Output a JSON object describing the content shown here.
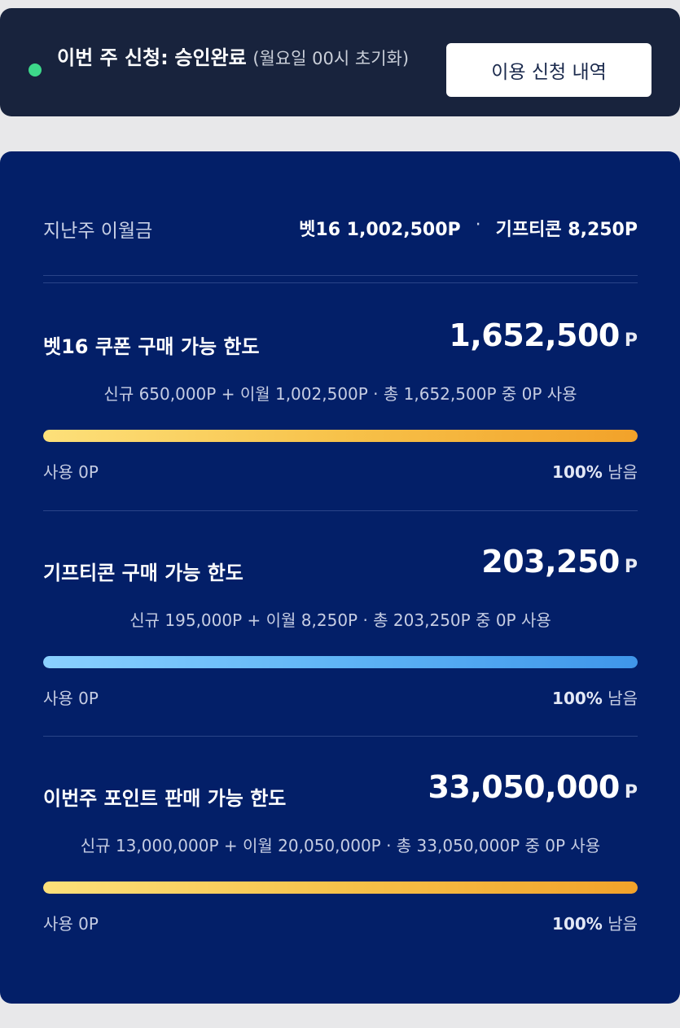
{
  "status": {
    "title_prefix": "이번 주 신청:",
    "title_value": "승인완료",
    "note": "(월요일 00시 초기화)",
    "history_button": "이용 신청 내역",
    "dot_color": "#3dd88a"
  },
  "carryover": {
    "label": "지난주 이월금",
    "bet_value": "벳16 1,002,500P",
    "separator": "·",
    "gift_value": "기프티콘 8,250P"
  },
  "sections": [
    {
      "title": "벳16 쿠폰 구매 가능 한도",
      "amount": "1,652,500",
      "unit": "P",
      "description": "신규 650,000P + 이월 1,002,500P · 총 1,652,500P 중 0P 사용",
      "used": "사용 0P",
      "remain_pct": "100%",
      "remain_label": "남음",
      "bar_level": 1.0,
      "bar_color": "gold"
    },
    {
      "title": "기프티콘 구매 가능 한도",
      "amount": "203,250",
      "unit": "P",
      "description": "신규 195,000P + 이월 8,250P · 총 203,250P 중 0P 사용",
      "used": "사용 0P",
      "remain_pct": "100%",
      "remain_label": "남음",
      "bar_level": 1.0,
      "bar_color": "blue"
    },
    {
      "title": "이번주 포인트 판매 가능 한도",
      "amount": "33,050,000",
      "unit": "P",
      "description": "신규 13,000,000P + 이월 20,050,000P · 총 33,050,000P 중 0P 사용",
      "used": "사용 0P",
      "remain_pct": "100%",
      "remain_label": "남음",
      "bar_level": 1.0,
      "bar_color": "gold"
    }
  ]
}
